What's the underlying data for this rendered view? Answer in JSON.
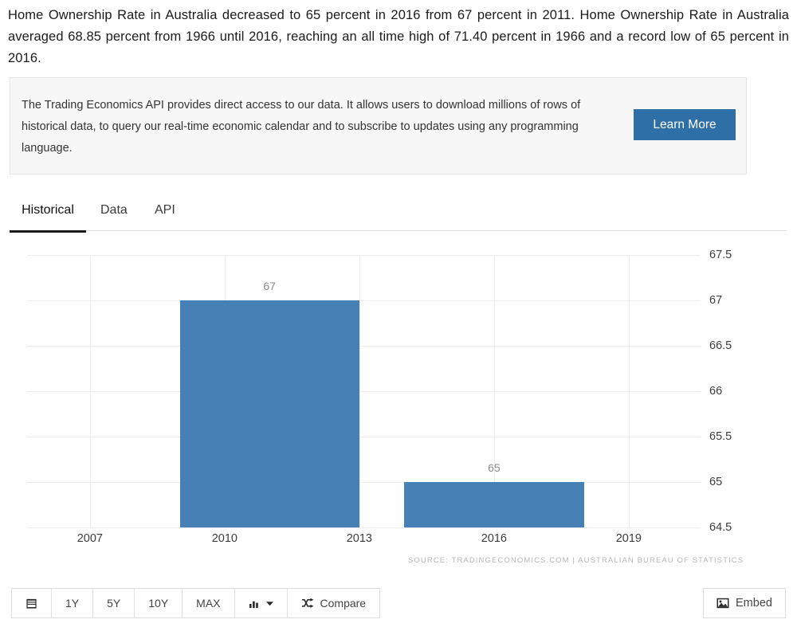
{
  "intro": {
    "paragraph": "Home Ownership Rate in Australia decreased to 65 percent in 2016 from 67 percent in 2011. Home Ownership Rate in Australia averaged 68.85 percent from 1966 until 2016, reaching an all time high of 71.40 percent in 1966 and a record low of 65 percent in 2016."
  },
  "promo": {
    "text": "The Trading Economics API provides direct access to our data. It allows users to download millions of rows of historical data, to query our real-time economic calendar and to subscribe to updates using any programming language.",
    "button_label": "Learn More",
    "button_color": "#2f6fa8"
  },
  "tabs": [
    {
      "label": "Historical",
      "active": true
    },
    {
      "label": "Data",
      "active": false
    },
    {
      "label": "API",
      "active": false
    }
  ],
  "chart_data": {
    "type": "bar",
    "title": "",
    "subtitle": "",
    "xlabel": "",
    "ylabel": "",
    "categories": [
      "2011",
      "2016"
    ],
    "values": [
      67,
      65
    ],
    "data_labels": [
      "67",
      "65"
    ],
    "ylim": [
      64.5,
      67.5
    ],
    "ytick_labels": [
      "67.5",
      "67",
      "66.5",
      "66",
      "65.5",
      "65",
      "64.5"
    ],
    "ytick_values": [
      67.5,
      67,
      66.5,
      66,
      65.5,
      65,
      64.5
    ],
    "xtick_labels": [
      "2007",
      "2010",
      "2013",
      "2016",
      "2019"
    ],
    "xtick_values": [
      2007,
      2010,
      2013,
      2016,
      2019
    ],
    "xlim": [
      2005.6,
      2020.6
    ],
    "bar_color": "#4680b4",
    "grid": "horizontal-and-vertical",
    "legend": "none",
    "axis_position": "right",
    "source_note": "SOURCE: TRADINGECONOMICS.COM | AUSTRALIAN BUREAU OF STATISTICS"
  },
  "toolbar": {
    "calendar_icon": "calendar-icon",
    "ranges": [
      "1Y",
      "5Y",
      "10Y",
      "MAX"
    ],
    "chart_type_icon": "bar-chart-icon",
    "chart_type_caret": "▾",
    "compare_icon": "shuffle-icon",
    "compare_label": "Compare",
    "embed_icon": "image-icon",
    "embed_label": "Embed"
  }
}
